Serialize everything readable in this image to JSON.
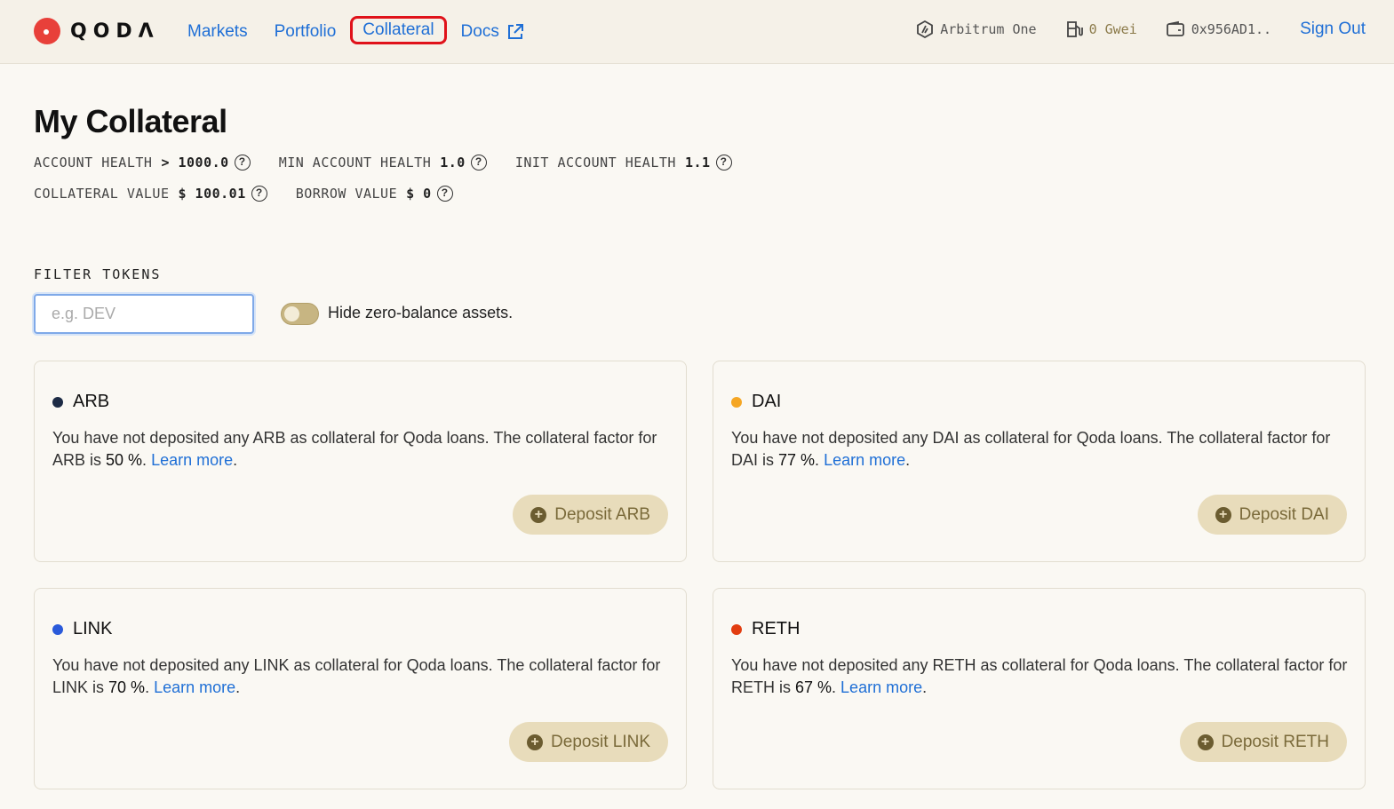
{
  "header": {
    "logo_text": "QODΛ",
    "nav": [
      {
        "label": "Markets"
      },
      {
        "label": "Portfolio"
      },
      {
        "label": "Collateral"
      },
      {
        "label": "Docs"
      }
    ],
    "network": "Arbitrum One",
    "gas": "0 Gwei",
    "wallet": "0x956AD1..",
    "signout": "Sign Out"
  },
  "page": {
    "title": "My Collateral",
    "stats": {
      "account_health_label": "ACCOUNT HEALTH",
      "account_health_value": "> 1000.0",
      "min_health_label": "MIN ACCOUNT HEALTH",
      "min_health_value": "1.0",
      "init_health_label": "INIT ACCOUNT HEALTH",
      "init_health_value": "1.1",
      "collateral_value_label": "COLLATERAL VALUE",
      "collateral_value_value": "$ 100.01",
      "borrow_value_label": "BORROW VALUE",
      "borrow_value_value": "$ 0"
    },
    "filter": {
      "label": "FILTER TOKENS",
      "placeholder": "e.g. DEV",
      "value": "",
      "toggle_label": "Hide zero-balance assets.",
      "toggle_on": false
    }
  },
  "tokens": [
    {
      "symbol": "ARB",
      "color": "#1d2b45",
      "text_pre": "You have not deposited any ARB as collateral for Qoda loans. The collateral factor for ARB is ",
      "factor": "50 %",
      "learn": "Learn more",
      "button": "Deposit ARB"
    },
    {
      "symbol": "DAI",
      "color": "#f5a623",
      "text_pre": "You have not deposited any DAI as collateral for Qoda loans. The collateral factor for DAI is ",
      "factor": "77 %",
      "learn": "Learn more",
      "button": "Deposit DAI"
    },
    {
      "symbol": "LINK",
      "color": "#2a5ada",
      "text_pre": "You have not deposited any LINK as collateral for Qoda loans. The collateral factor for LINK is ",
      "factor": "70 %",
      "learn": "Learn more",
      "button": "Deposit LINK"
    },
    {
      "symbol": "RETH",
      "color": "#e23d10",
      "text_pre": "You have not deposited any RETH as collateral for Qoda loans. The collateral factor for RETH is ",
      "factor": "67 %",
      "learn": "Learn more",
      "button": "Deposit RETH"
    }
  ]
}
